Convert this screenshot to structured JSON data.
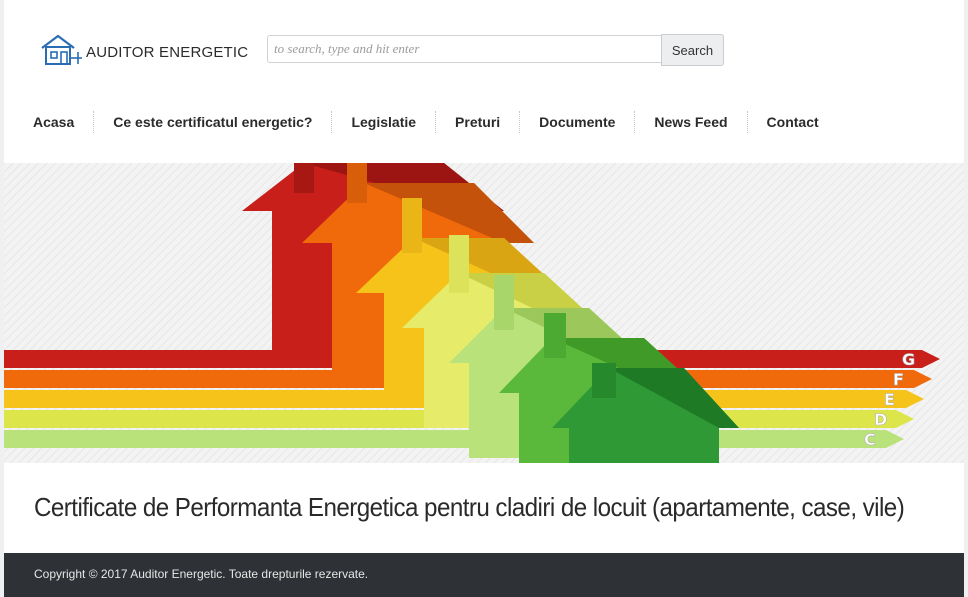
{
  "header": {
    "logo_text": "Auditor Energetic",
    "logo_icon": "house-outline-icon",
    "search_placeholder": "to search, type and hit enter",
    "search_button": "Search"
  },
  "nav": {
    "items": [
      {
        "label": "Acasa"
      },
      {
        "label": "Ce este certificatul energetic?"
      },
      {
        "label": "Legislatie"
      },
      {
        "label": "Preturi"
      },
      {
        "label": "Documente"
      },
      {
        "label": "News Feed"
      },
      {
        "label": "Contact"
      }
    ]
  },
  "hero": {
    "energy_classes": [
      "G",
      "F",
      "E",
      "D",
      "C"
    ],
    "colors": {
      "G": "#c81f1a",
      "F": "#f06a0c",
      "E": "#f6c31a",
      "D": "#dce64b",
      "C": "#9ed05a",
      "B": "#5ab83a",
      "A": "#2f9a35"
    }
  },
  "main": {
    "headline": "Certificate de Performanta Energetica pentru cladiri de locuit (apartamente, case, vile)"
  },
  "footer": {
    "copyright": "Copyright © 2017 Auditor Energetic. Toate drepturile rezervate."
  },
  "colors": {
    "footer_bg": "#2e3236",
    "text": "#2b2b2b"
  }
}
